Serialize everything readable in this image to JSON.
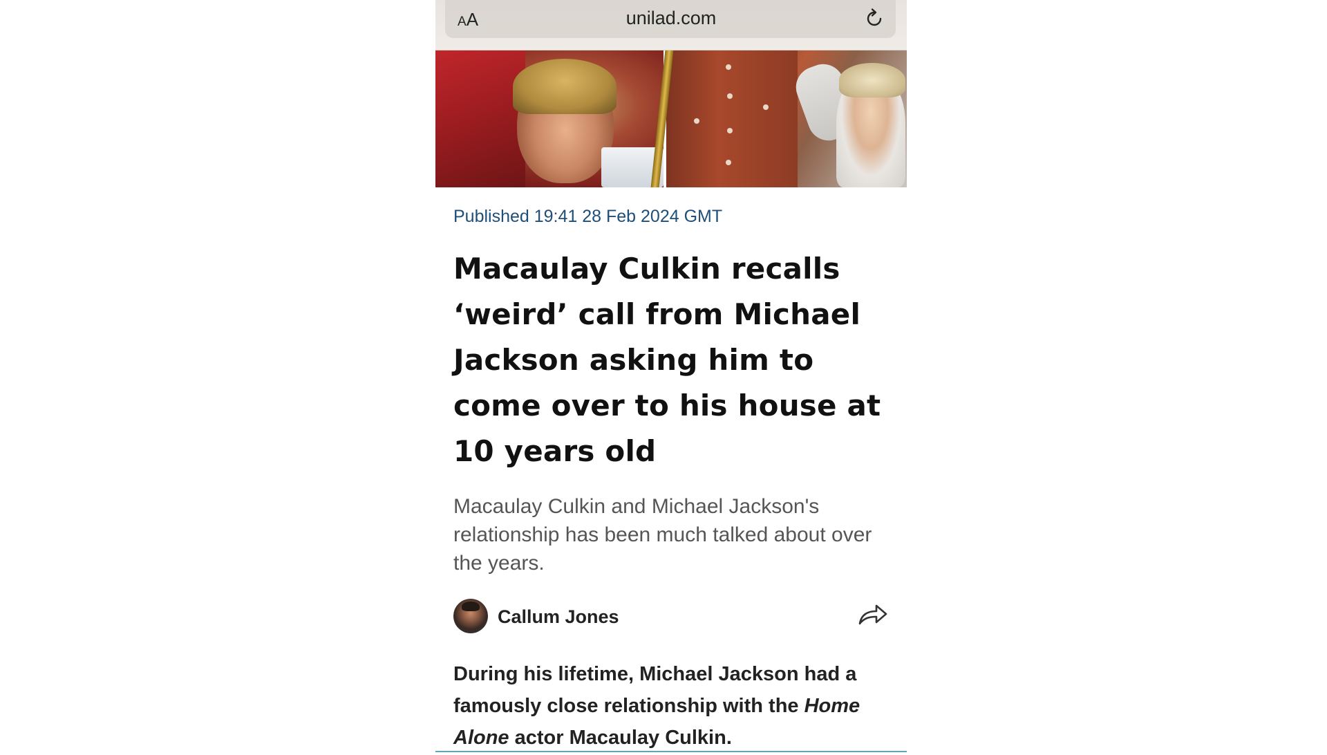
{
  "browser": {
    "text_size_button": "AA",
    "text_size_small": "A",
    "text_size_large": "A",
    "url": "unilad.com",
    "reload_icon": "reload-icon"
  },
  "article": {
    "published": "Published 19:41 28 Feb 2024 GMT",
    "headline": "Macaulay Culkin recalls ‘weird’ call from Michael Jackson asking him to come over to his house at 10 years old",
    "subtitle": "Macaulay Culkin and Michael Jackson's relationship has been much talked about over the years.",
    "author": "Callum Jones",
    "share_icon": "share-icon",
    "body": {
      "part1": "During his lifetime, Michael Jackson had a famously close relationship with the ",
      "italic": "Home Alone",
      "part2": " actor Macaulay Culkin."
    }
  },
  "colors": {
    "published_text": "#1f4e79",
    "headline_text": "#111111",
    "subtitle_text": "#555555",
    "accent_divider": "#e0b84a"
  }
}
